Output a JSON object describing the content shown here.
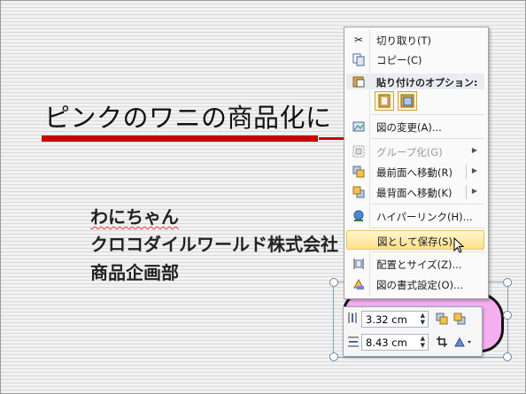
{
  "slide": {
    "title": "ピンクのワニの商品化に",
    "lines": [
      "わにちゃん",
      "クロコダイルワールド株式会社",
      "商品企画部"
    ]
  },
  "context_menu": {
    "items": [
      {
        "label": "切り取り(T)",
        "icon": "scissors-icon"
      },
      {
        "label": "コピー(C)",
        "icon": "copy-icon"
      },
      {
        "label": "貼り付けのオプション:",
        "icon": "paste-icon"
      },
      {
        "label": "図の変更(A)...",
        "icon": "change-picture-icon"
      },
      {
        "label": "グループ化(G)",
        "icon": "group-icon",
        "disabled": true
      },
      {
        "label": "最前面へ移動(R)",
        "icon": "bring-front-icon"
      },
      {
        "label": "最背面へ移動(K)",
        "icon": "send-back-icon"
      },
      {
        "label": "ハイパーリンク(H)...",
        "icon": "hyperlink-icon"
      },
      {
        "label": "図として保存(S)...",
        "icon": "save-as-picture-icon",
        "highlighted": true
      },
      {
        "label": "配置とサイズ(Z)...",
        "icon": "size-position-icon"
      },
      {
        "label": "図の書式設定(O)...",
        "icon": "format-picture-icon"
      }
    ]
  },
  "mini_toolbar": {
    "height_value": "3.32 cm",
    "width_value": "8.43 cm"
  }
}
